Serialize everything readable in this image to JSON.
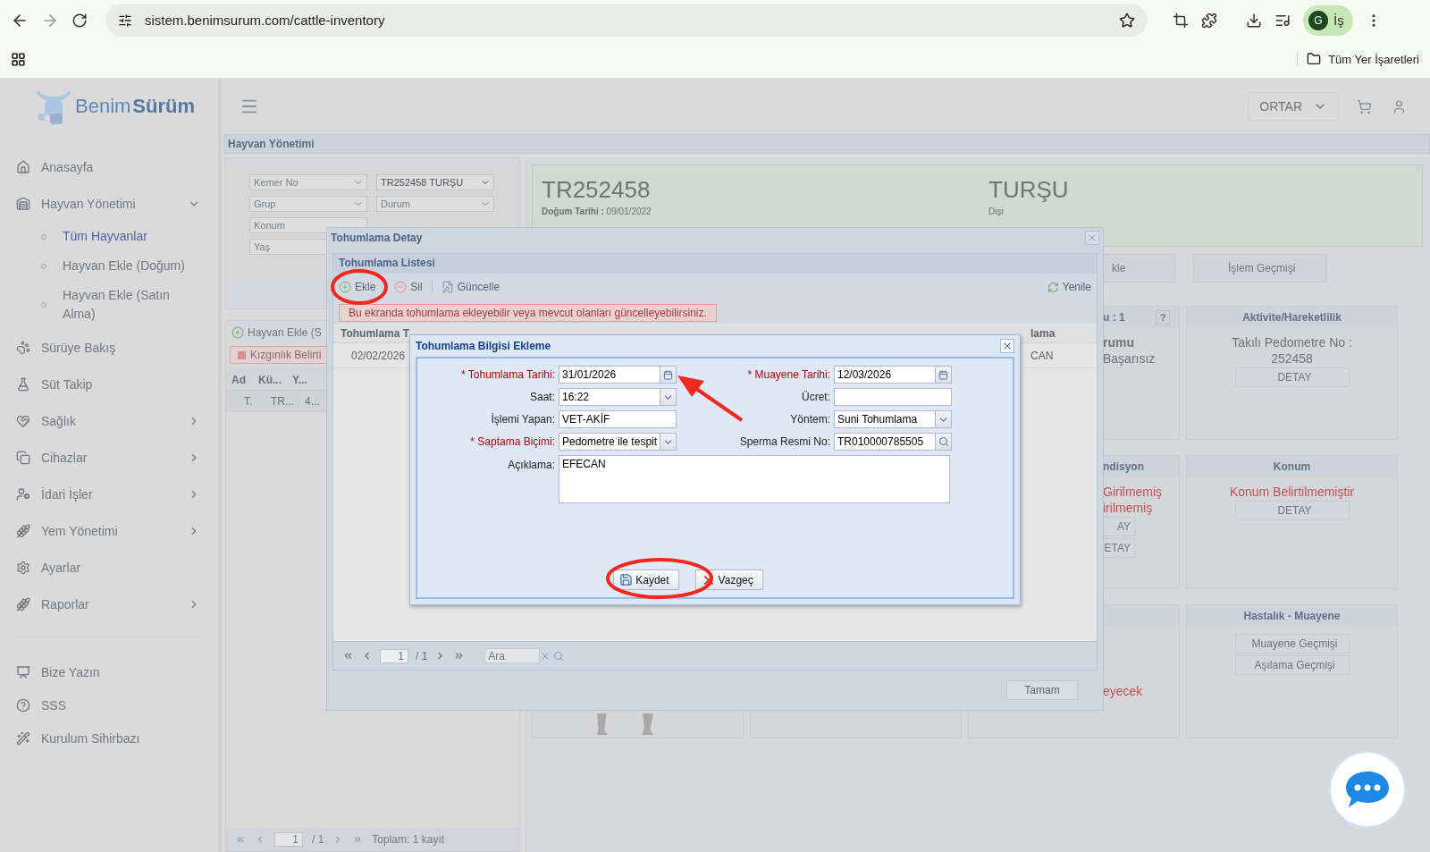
{
  "browser": {
    "url": "sistem.benimsurum.com/cattle-inventory",
    "profile_initial": "G",
    "profile_label": "İş",
    "bookmarks_folder": "Tüm Yer İşaretleri"
  },
  "app": {
    "logo_first": "Benim",
    "logo_second": "Sürüm",
    "organization": "ORTAR"
  },
  "sidebar": {
    "items": [
      {
        "label": "Anasayfa",
        "expandable": false
      },
      {
        "label": "Hayvan Yönetimi",
        "expandable": true,
        "expanded": true,
        "children": [
          {
            "label": "Tüm Hayvanlar",
            "selected": true
          },
          {
            "label": "Hayvan Ekle (Doğum)",
            "selected": false
          },
          {
            "label": "Hayvan Ekle (Satın Alma)",
            "selected": false
          }
        ]
      },
      {
        "label": "Sürüye Bakış",
        "expandable": false
      },
      {
        "label": "Süt Takip",
        "expandable": false
      },
      {
        "label": "Sağlık",
        "expandable": true,
        "expanded": false
      },
      {
        "label": "Cihazlar",
        "expandable": true,
        "expanded": false
      },
      {
        "label": "İdari İşler",
        "expandable": true,
        "expanded": false
      },
      {
        "label": "Yem Yönetimi",
        "expandable": true,
        "expanded": false
      },
      {
        "label": "Ayarlar",
        "expandable": false
      },
      {
        "label": "Raporlar",
        "expandable": true,
        "expanded": false
      }
    ],
    "footer_items": [
      {
        "label": "Bize Yazın"
      },
      {
        "label": "SSS"
      },
      {
        "label": "Kurulum Sihirbazı"
      }
    ]
  },
  "page_title": "Hayvan Yönetimi",
  "filters": [
    {
      "kind": "combo",
      "placeholder": "Kemer No"
    },
    {
      "kind": "combo",
      "value": "TR252458 TURŞU"
    },
    {
      "kind": "combo",
      "placeholder": "Grup"
    },
    {
      "kind": "combo",
      "placeholder": "Durum"
    },
    {
      "kind": "text",
      "placeholder": "Konum"
    },
    {
      "kind": "text",
      "placeholder": "Yaş"
    }
  ],
  "animal_list": {
    "add_button": "Hayvan Ekle (S",
    "tag": "Kızgınlık Belirti",
    "columns": [
      "Ad",
      "Kü...",
      "Y..."
    ],
    "row": [
      "T.",
      "TR...",
      "4..."
    ],
    "pager": {
      "page": "1",
      "total": "/ 1",
      "summary": "Toplam: 1 kayıt"
    }
  },
  "animal": {
    "id": "TR252458",
    "birth_label": "Doğum Tarihi :",
    "birth_date": "09/01/2022",
    "name": "TURŞU",
    "sex": "Dişi",
    "actions": [
      "kle",
      "İşlem Geçmişi"
    ]
  },
  "card_rows": [
    {
      "cards": [
        {
          "kind": "status",
          "title": "u : 1",
          "help": "?",
          "lines": [
            {
              "text": "rumu",
              "bold": true,
              "alert": false
            },
            {
              "text": "Başarısız",
              "bold": false,
              "alert": false
            }
          ]
        },
        {
          "kind": "status",
          "title": "Aktivite/Hareketlilik",
          "lines": [
            {
              "text": "Takılı Pedometre No :",
              "bold": false,
              "alert": false
            },
            {
              "text": "252458",
              "bold": false,
              "alert": false
            }
          ],
          "buttons": [
            "DETAY"
          ]
        }
      ]
    },
    {
      "cards": [
        {
          "kind": "status",
          "title": "ndisyon",
          "lines": [
            {
              "text": "Girilmemiş",
              "bold": false,
              "alert": true
            },
            {
              "text": "irilmemiş",
              "bold": false,
              "alert": true
            }
          ],
          "buttons": [
            "AY",
            "ETAY"
          ]
        },
        {
          "kind": "status",
          "title": "Konum",
          "lines": [
            {
              "text": "Konum Belirtilmemiştir",
              "bold": false,
              "alert": true
            }
          ],
          "buttons": [
            "DETAY"
          ]
        }
      ]
    },
    {
      "cards": [
        {
          "kind": "picture"
        },
        {
          "kind": "blank"
        },
        {
          "kind": "note",
          "lines": [
            {
              "text": "eyecek",
              "bold": false,
              "alert": true
            }
          ]
        },
        {
          "kind": "status",
          "title": "Hastalık - Muayene",
          "buttons": [
            "Muayene Geçmişi",
            "Aşılama Geçmişi"
          ]
        }
      ]
    }
  ],
  "detail_dialog": {
    "title": "Tohumlama Detay",
    "list_title": "Tohumlama Listesi",
    "toolbar": [
      "Ekle",
      "Sil",
      "Güncelle"
    ],
    "refresh": "Yenile",
    "info": "Bu ekranda tohumlama ekleyebilir veya mevcut olanları güncelleyebilirsiniz.",
    "columns": [
      "Tohumlama T",
      "lama"
    ],
    "row": [
      "02/02/2026",
      "CAN"
    ],
    "pager": {
      "page": "1",
      "total": "/ 1",
      "search_placeholder": "Ara"
    },
    "ok": "Tamam"
  },
  "form_dialog": {
    "title": "Tohumlama Bilgisi Ekleme",
    "fields": [
      {
        "label": "* Tohumlama Tarihi:",
        "required": true,
        "kind": "date",
        "value": "31/01/2026"
      },
      {
        "label": "* Muayene Tarihi:",
        "required": true,
        "kind": "date",
        "value": "12/03/2026"
      },
      {
        "label": "Saat:",
        "required": false,
        "kind": "combo",
        "value": "16:22"
      },
      {
        "label": "Ücret:",
        "required": false,
        "kind": "text"
      },
      {
        "label": "İşlemi Yapan:",
        "required": false,
        "kind": "text",
        "value": "VET-AKİF"
      },
      {
        "label": "Yöntem:",
        "required": false,
        "kind": "combo",
        "value": "Suni Tohumlama"
      },
      {
        "label": "* Saptama Biçimi:",
        "required": true,
        "kind": "combo",
        "value": "Pedometre ile tespit"
      },
      {
        "label": "Sperma Resmi No:",
        "required": false,
        "kind": "search",
        "value": "TR010000785505"
      }
    ],
    "note": {
      "label": "Açıklama:",
      "value": "EFECAN"
    },
    "buttons": [
      "Kaydet",
      "Vazgeç"
    ]
  }
}
